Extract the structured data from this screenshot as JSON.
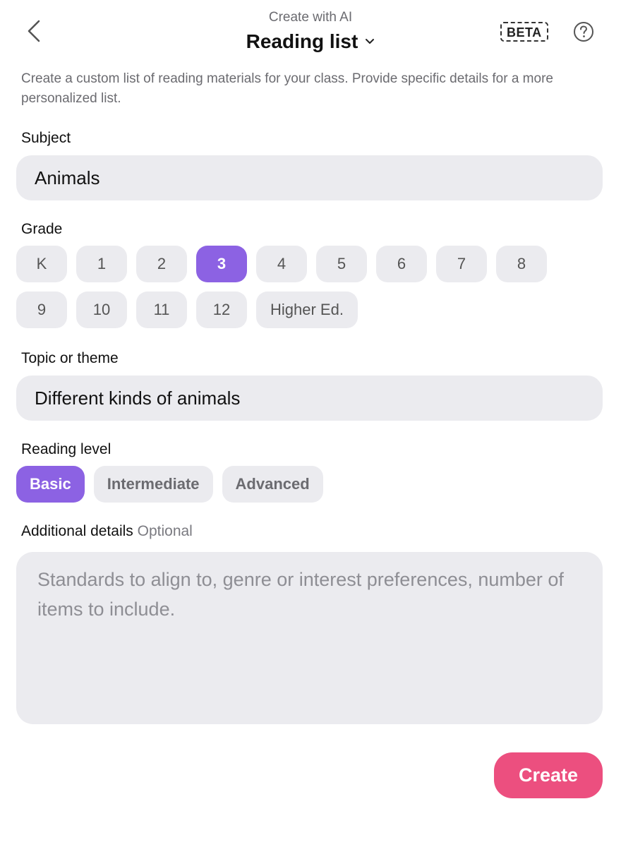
{
  "header": {
    "eyebrow": "Create with AI",
    "title": "Reading list",
    "badge": "BETA"
  },
  "description": "Create a custom list of reading materials for your class. Provide specific details for a more personalized list.",
  "subject": {
    "label": "Subject",
    "value": "Animals"
  },
  "grade": {
    "label": "Grade",
    "options": [
      "K",
      "1",
      "2",
      "3",
      "4",
      "5",
      "6",
      "7",
      "8",
      "9",
      "10",
      "11",
      "12",
      "Higher Ed."
    ],
    "selected": "3"
  },
  "topic": {
    "label": "Topic or theme",
    "value": "Different kinds of animals"
  },
  "reading_level": {
    "label": "Reading level",
    "options": [
      "Basic",
      "Intermediate",
      "Advanced"
    ],
    "selected": "Basic"
  },
  "additional_details": {
    "label": "Additional details",
    "optional_label": "Optional",
    "placeholder": "Standards to align to, genre or interest preferences, number of items to include."
  },
  "create_label": "Create",
  "colors": {
    "accent_purple": "#8c62e3",
    "create_pink": "#ec4f7f",
    "field_bg": "#ebebef"
  },
  "icons": [
    "chevron-left-icon",
    "chevron-down-icon",
    "help-circle-icon"
  ]
}
